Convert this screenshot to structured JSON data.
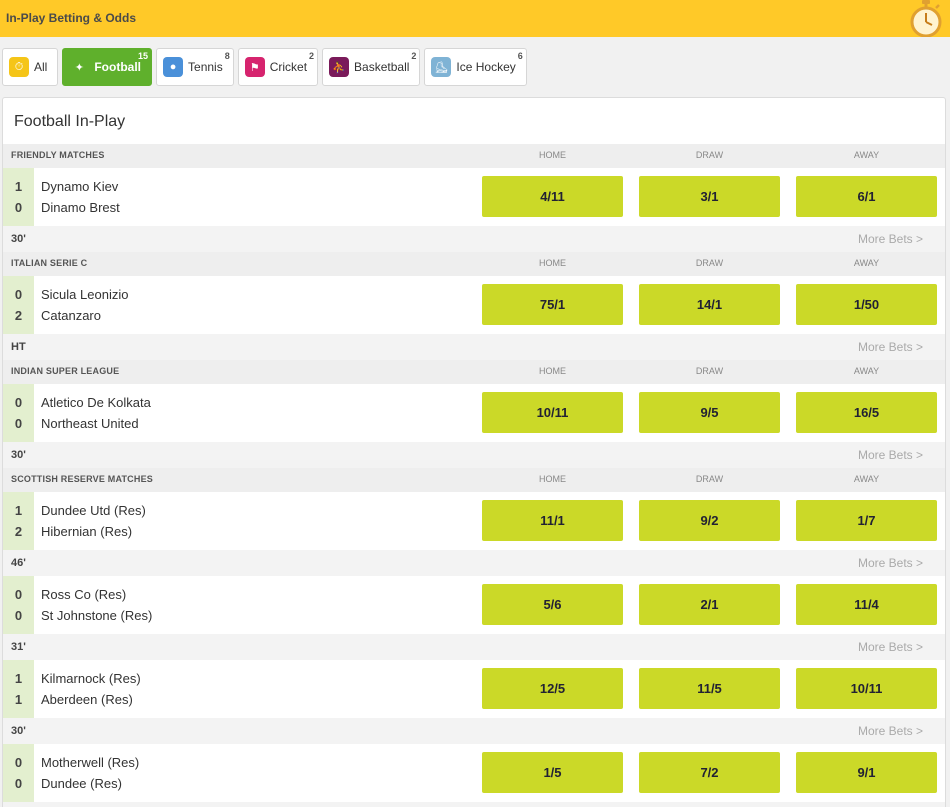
{
  "header": {
    "title": "In-Play Betting & Odds",
    "stopwatch_icon": "stopwatch-icon"
  },
  "tabs": [
    {
      "label": "All",
      "count": "",
      "icon": "stopwatch-icon",
      "icon_color": "#f5c518",
      "active": false
    },
    {
      "label": "Football",
      "count": "15",
      "icon": "football-player-icon",
      "icon_color": "#5fb02c",
      "active": true
    },
    {
      "label": "Tennis",
      "count": "8",
      "icon": "tennis-icon",
      "icon_color": "#4a90d9",
      "active": false
    },
    {
      "label": "Cricket",
      "count": "2",
      "icon": "cricket-icon",
      "icon_color": "#d6246e",
      "active": false
    },
    {
      "label": "Basketball",
      "count": "2",
      "icon": "basketball-icon",
      "icon_color": "#7a1a5a",
      "active": false
    },
    {
      "label": "Ice Hockey",
      "count": "6",
      "icon": "ice-hockey-icon",
      "icon_color": "#7fb3d5",
      "active": false
    }
  ],
  "panel": {
    "title": "Football In-Play",
    "more_label": "More Bets >"
  },
  "columns": {
    "home": "HOME",
    "draw": "DRAW",
    "away": "AWAY"
  },
  "leagues": [
    {
      "name": "FRIENDLY MATCHES",
      "matches": [
        {
          "home": "Dynamo Kiev",
          "away": "Dinamo Brest",
          "home_score": "1",
          "away_score": "0",
          "odds": [
            "4/11",
            "3/1",
            "6/1"
          ],
          "time": "30'"
        }
      ]
    },
    {
      "name": "ITALIAN SERIE C",
      "matches": [
        {
          "home": "Sicula Leonizio",
          "away": "Catanzaro",
          "home_score": "0",
          "away_score": "2",
          "odds": [
            "75/1",
            "14/1",
            "1/50"
          ],
          "time": "HT"
        }
      ]
    },
    {
      "name": "INDIAN SUPER LEAGUE",
      "matches": [
        {
          "home": "Atletico De Kolkata",
          "away": "Northeast United",
          "home_score": "0",
          "away_score": "0",
          "odds": [
            "10/11",
            "9/5",
            "16/5"
          ],
          "time": "30'"
        }
      ]
    },
    {
      "name": "SCOTTISH RESERVE MATCHES",
      "matches": [
        {
          "home": "Dundee Utd (Res)",
          "away": "Hibernian (Res)",
          "home_score": "1",
          "away_score": "2",
          "odds": [
            "11/1",
            "9/2",
            "1/7"
          ],
          "time": "46'"
        },
        {
          "home": "Ross Co (Res)",
          "away": "St Johnstone (Res)",
          "home_score": "0",
          "away_score": "0",
          "odds": [
            "5/6",
            "2/1",
            "11/4"
          ],
          "time": "31'"
        },
        {
          "home": "Kilmarnock (Res)",
          "away": "Aberdeen (Res)",
          "home_score": "1",
          "away_score": "1",
          "odds": [
            "12/5",
            "11/5",
            "10/11"
          ],
          "time": "30'"
        },
        {
          "home": "Motherwell (Res)",
          "away": "Dundee (Res)",
          "home_score": "0",
          "away_score": "0",
          "odds": [
            "1/5",
            "7/2",
            "9/1"
          ],
          "time": ""
        }
      ]
    }
  ],
  "colors": {
    "header_bg": "#ffc928",
    "active_tab": "#5fb02c",
    "odds_button": "#cbd928",
    "score_bg": "#e3efcf"
  }
}
